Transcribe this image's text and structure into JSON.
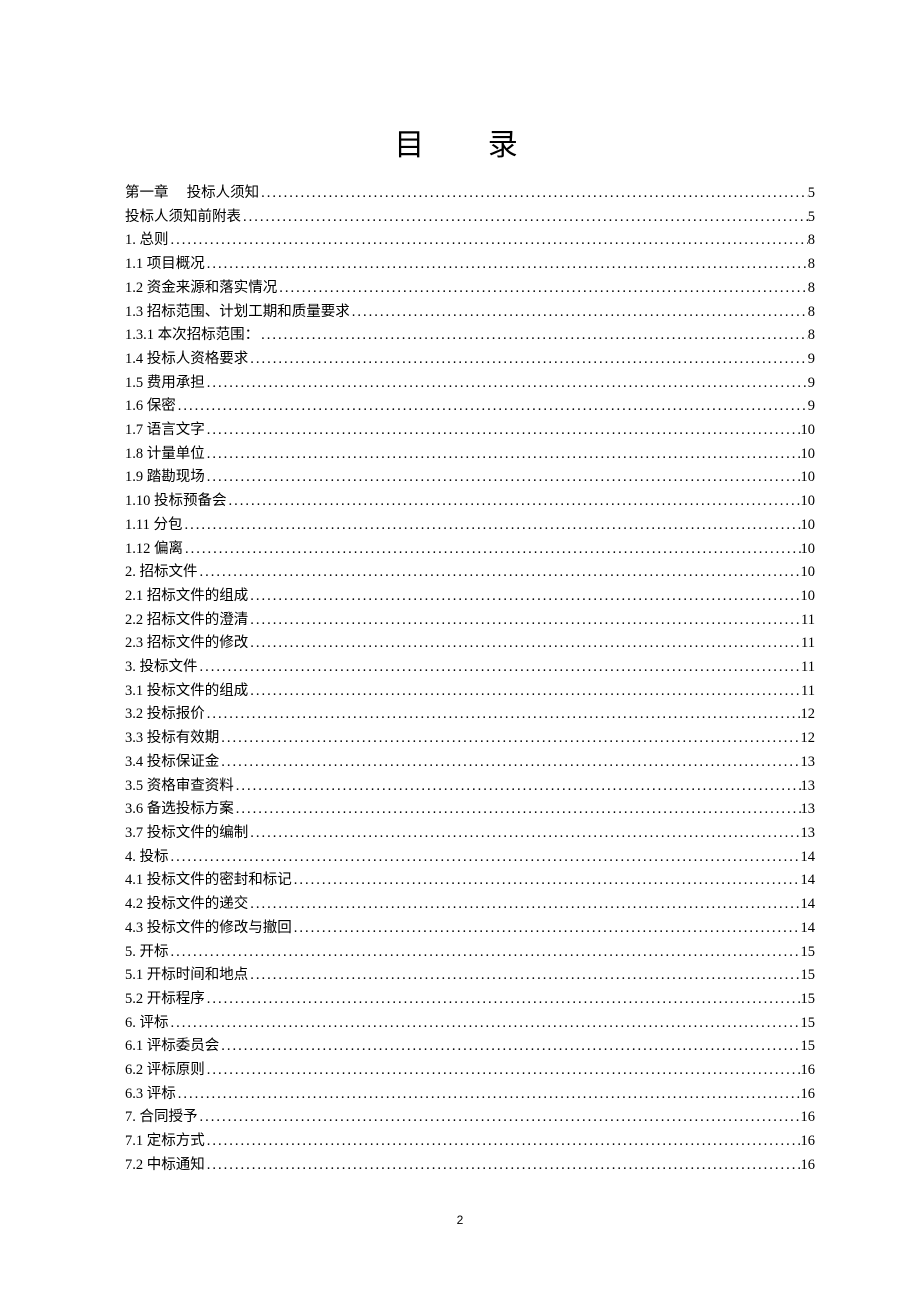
{
  "title": "目 录",
  "pageNumber": "2",
  "toc": [
    {
      "label": "第一章　 投标人须知",
      "page": "5"
    },
    {
      "label": "投标人须知前附表",
      "page": "5"
    },
    {
      "label": "1. 总则",
      "page": "8"
    },
    {
      "label": "1.1 项目概况",
      "page": "8"
    },
    {
      "label": "1.2 资金来源和落实情况",
      "page": "8"
    },
    {
      "label": "1.3 招标范围、计划工期和质量要求",
      "page": "8"
    },
    {
      "label": "1.3.1 本次招标范围：",
      "page": "8"
    },
    {
      "label": "1.4 投标人资格要求",
      "page": "9"
    },
    {
      "label": "1.5 费用承担",
      "page": "9"
    },
    {
      "label": "1.6 保密",
      "page": "9"
    },
    {
      "label": "1.7 语言文字",
      "page": "10"
    },
    {
      "label": "1.8 计量单位",
      "page": "10"
    },
    {
      "label": "1.9 踏勘现场",
      "page": "10"
    },
    {
      "label": "1.10 投标预备会",
      "page": "10"
    },
    {
      "label": "1.11 分包",
      "page": "10"
    },
    {
      "label": "1.12 偏离",
      "page": "10"
    },
    {
      "label": "2. 招标文件",
      "page": "10"
    },
    {
      "label": "2.1 招标文件的组成",
      "page": "10"
    },
    {
      "label": "2.2 招标文件的澄清",
      "page": "11"
    },
    {
      "label": "2.3 招标文件的修改",
      "page": "11"
    },
    {
      "label": "3. 投标文件",
      "page": "11"
    },
    {
      "label": "3.1 投标文件的组成",
      "page": "11"
    },
    {
      "label": "3.2 投标报价",
      "page": "12"
    },
    {
      "label": "3.3 投标有效期",
      "page": "12"
    },
    {
      "label": "3.4 投标保证金",
      "page": "13"
    },
    {
      "label": "3.5 资格审查资料",
      "page": "13"
    },
    {
      "label": "3.6 备选投标方案",
      "page": "13"
    },
    {
      "label": "3.7 投标文件的编制",
      "page": "13"
    },
    {
      "label": "4. 投标",
      "page": "14"
    },
    {
      "label": "4.1 投标文件的密封和标记",
      "page": "14"
    },
    {
      "label": "4.2 投标文件的递交",
      "page": "14"
    },
    {
      "label": "4.3 投标文件的修改与撤回",
      "page": "14"
    },
    {
      "label": "5. 开标",
      "page": "15"
    },
    {
      "label": "5.1 开标时间和地点",
      "page": "15"
    },
    {
      "label": "5.2 开标程序",
      "page": "15"
    },
    {
      "label": "6. 评标",
      "page": "15"
    },
    {
      "label": "6.1 评标委员会",
      "page": "15"
    },
    {
      "label": "6.2 评标原则",
      "page": "16"
    },
    {
      "label": "6.3 评标",
      "page": "16"
    },
    {
      "label": "7. 合同授予",
      "page": "16"
    },
    {
      "label": "7.1 定标方式",
      "page": "16"
    },
    {
      "label": "7.2 中标通知",
      "page": "16"
    }
  ]
}
